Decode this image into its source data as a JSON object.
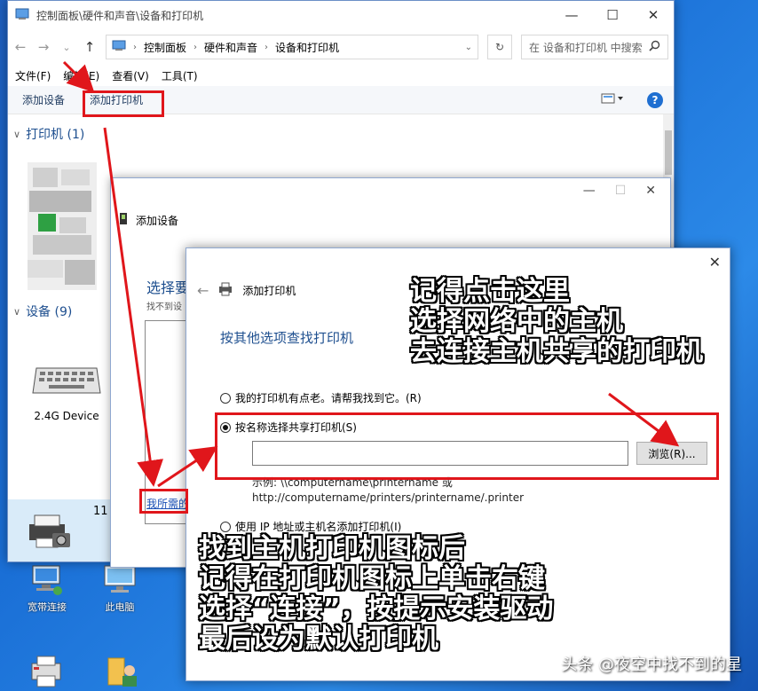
{
  "desktop": {
    "icons": [
      {
        "label": "宽带连接"
      },
      {
        "label": "此电脑"
      }
    ]
  },
  "explorer": {
    "title": "控制面板\\硬件和声音\\设备和打印机",
    "controls": {
      "minimize": "—",
      "maximize": "☐",
      "close": "✕"
    },
    "nav": {
      "back": "←",
      "forward": "→",
      "dropdown": "⌄",
      "up": "↑"
    },
    "breadcrumb": [
      "控制面板",
      "硬件和声音",
      "设备和打印机"
    ],
    "refresh": "↻",
    "search_placeholder": "在 设备和打印机 中搜索",
    "menu": [
      "文件(F)",
      "编辑(E)",
      "查看(V)",
      "工具(T)"
    ],
    "toolbar": {
      "add_device": "添加设备",
      "add_printer": "添加打印机",
      "help": "?"
    },
    "groups": {
      "printers": "打印机 (1)",
      "devices": "设备 (9)"
    },
    "devices": {
      "device1": "2.4G Device",
      "count_partial": "11"
    }
  },
  "add_device_dialog": {
    "title": "添加设备",
    "heading_partial": "选择要",
    "subtext_partial": "找不到设",
    "link_partial": "我所需的"
  },
  "add_printer_dialog": {
    "title": "添加打印机",
    "close": "✕",
    "heading": "按其他选项查找打印机",
    "options": {
      "old_printer": "我的打印机有点老。请帮我找到它。(R)",
      "by_name": "按名称选择共享打印机(S)",
      "by_ip": "使用 IP 地址或主机名添加打印机(I)"
    },
    "browse": "浏览(R)...",
    "example_line1": "示例: \\\\computername\\printername 或",
    "example_line2": "http://computername/printers/printername/.printer"
  },
  "annotations": {
    "top": [
      "记得点击这里",
      "选择网络中的主机",
      "去连接主机共享的打印机"
    ],
    "bottom": [
      "找到主机打印机图标后",
      "记得在打印机图标上单击右键",
      "选择“连接”，按提示安装驱动",
      "最后设为默认打印机"
    ]
  },
  "watermark": "头条 @夜空中找不到的星",
  "colors": {
    "highlight": "#e0161b",
    "link": "#1a4fb5",
    "heading": "#1e4f8f"
  }
}
